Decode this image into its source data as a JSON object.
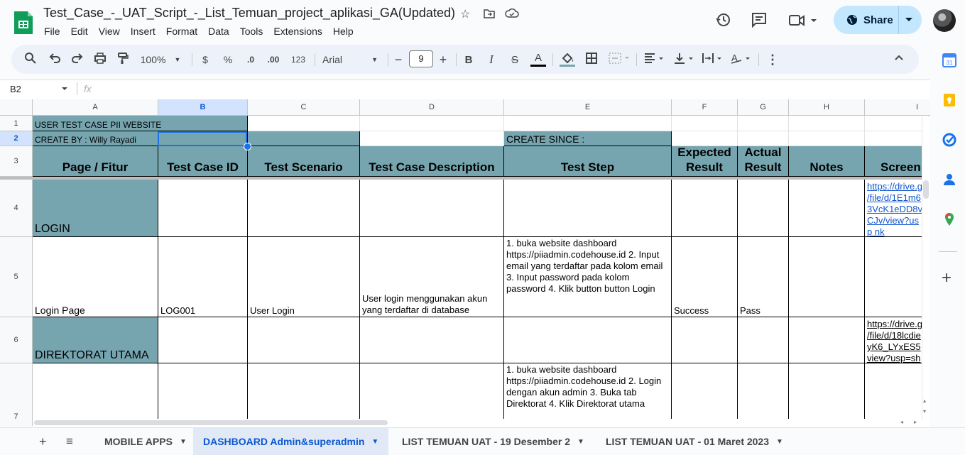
{
  "app": {
    "doc_title": "Test_Case_-_UAT_Script_-_List_Temuan_project_aplikasi_GA(Updated)",
    "menu": [
      "File",
      "Edit",
      "View",
      "Insert",
      "Format",
      "Data",
      "Tools",
      "Extensions",
      "Help"
    ],
    "share_label": "Share",
    "brand_color": "#0f9d58",
    "accent_color": "#c2e7ff"
  },
  "toolbar": {
    "zoom": "100%",
    "currency": "$",
    "percent": "%",
    "dec_decrease": ".0",
    "dec_increase": ".00",
    "number_format": "123",
    "font": "Arial",
    "font_size": "9",
    "icons": [
      "search-icon",
      "undo-icon",
      "redo-icon",
      "print-icon",
      "paint-format-icon",
      "bold-icon",
      "italic-icon",
      "strikethrough-icon",
      "text-color-icon",
      "fill-color-icon",
      "borders-icon",
      "merge-icon",
      "align-icon",
      "valign-icon",
      "wrap-icon",
      "rotate-icon",
      "more-icon",
      "collapse-icon"
    ]
  },
  "formula_bar": {
    "name_box": "B2",
    "fx": "fx",
    "value": ""
  },
  "columns": [
    "A",
    "B",
    "C",
    "D",
    "E",
    "F",
    "G",
    "H",
    "I"
  ],
  "rows": [
    "1",
    "2",
    "3",
    "4",
    "5",
    "6",
    "7"
  ],
  "cells": {
    "a1": "USER TEST CASE PII WEBSITE",
    "a2": "CREATE BY : Willy Rayadi",
    "e2": "CREATE SINCE :",
    "h_page": "Page / Fitur",
    "h_id": "Test Case ID",
    "h_scenario": "Test Scenario",
    "h_desc": "Test Case Description",
    "h_step": "Test Step",
    "h_expected": "Expected Result",
    "h_actual": "Actual Result",
    "h_notes": "Notes",
    "h_screen": "Screen",
    "a4": "LOGIN",
    "i4": "https://drive.g /file/d/1E1m6 3VcK1eDD8v CJv/view?usp nk",
    "a5": "Login Page",
    "b5": "LOG001",
    "c5": "User Login",
    "d5": "User login menggunakan akun yang terdaftar di database",
    "e5": "1. buka website dashboard https://piiadmin.codehouse.id 2. Input email yang terdaftar pada kolom email 3. Input password pada kolom password 4. Klik button button Login",
    "f5": "Success",
    "g5": "Pass",
    "a6": "DIREKTORAT UTAMA",
    "i6": "https://drive.g /file/d/18lcdie yK6_LYxES5 view?usp=sh",
    "e7": "1. buka website dashboard https://piiadmin.codehouse.id 2. Login dengan akun admin 3. Buka tab Direktorat 4. Klik Direktorat utama"
  },
  "sheet_tabs": [
    {
      "label": "MOBILE APPS",
      "active": false
    },
    {
      "label": "DASHBOARD Admin&superadmin",
      "active": true
    },
    {
      "label": "LIST TEMUAN UAT - 19 Desember 2",
      "active": false
    },
    {
      "label": "LIST TEMUAN UAT - 01 Maret 2023",
      "active": false
    }
  ],
  "colors": {
    "teal_fill": "#76a5af",
    "selection": "#1a73e8",
    "link": "#1155cc"
  }
}
